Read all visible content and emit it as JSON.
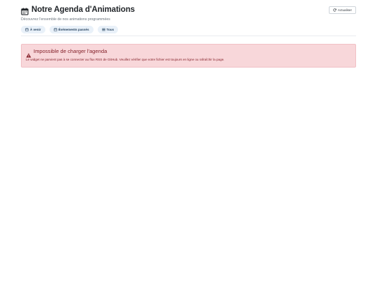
{
  "header": {
    "title": "Notre Agenda d'Animations",
    "subtitle": "Découvrez l'ensemble de nos animations programmées",
    "title_icon": "calendar-icon",
    "refresh_label": "Actualiser",
    "refresh_icon": "refresh-icon"
  },
  "filters": [
    {
      "label": "À venir",
      "icon": "calendar-icon"
    },
    {
      "label": "Événements passés",
      "icon": "calendar-icon"
    },
    {
      "label": "Tous",
      "icon": "list-icon"
    }
  ],
  "alert": {
    "icon": "warning-icon",
    "title": "Impossible de charger l'agenda",
    "message": "Le widget ne parvient pas à se connecter au flux RSS de GitHub. Veuillez vérifier que votre fichier est toujours en ligne ou rafraîchir la page."
  },
  "colors": {
    "title": "#212529",
    "muted": "#6c757d",
    "filter_bg": "#e9f1f9",
    "filter_text": "#1f3c5a",
    "alert_bg": "#f8d7da",
    "alert_text": "#842029"
  }
}
